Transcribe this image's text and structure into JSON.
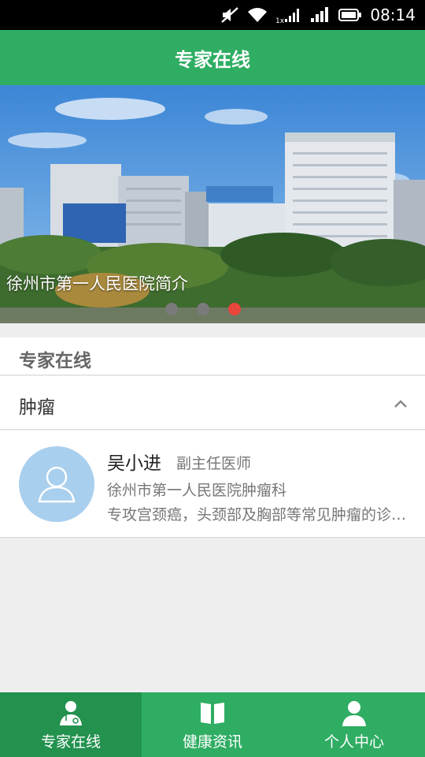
{
  "status_bar": {
    "time": "08:14",
    "icons": [
      "mute-icon",
      "wifi-icon",
      "signal-1x-icon",
      "signal-icon",
      "battery-icon"
    ]
  },
  "header": {
    "title": "专家在线"
  },
  "banner": {
    "caption": "徐州市第一人民医院简介",
    "slide_count": 3,
    "active_slide": 3
  },
  "section": {
    "title": "专家在线"
  },
  "category": {
    "label": "肿瘤",
    "expanded": true
  },
  "doctors": [
    {
      "name": "吴小进",
      "title": "副主任医师",
      "hospital": "徐州市第一人民医院肿瘤科",
      "description": "专攻宫颈癌，头颈部及胸部等常见肿瘤的诊断与治疗"
    }
  ],
  "bottom_nav": {
    "items": [
      {
        "label": "专家在线",
        "icon": "doctor-icon",
        "active": true
      },
      {
        "label": "健康资讯",
        "icon": "book-icon",
        "active": false
      },
      {
        "label": "个人中心",
        "icon": "person-icon",
        "active": false
      }
    ]
  },
  "colors": {
    "primary": "#2fad63",
    "primary_dark": "#23924f",
    "avatar_bg": "#a9cfee",
    "dot_active": "#e8453c"
  }
}
